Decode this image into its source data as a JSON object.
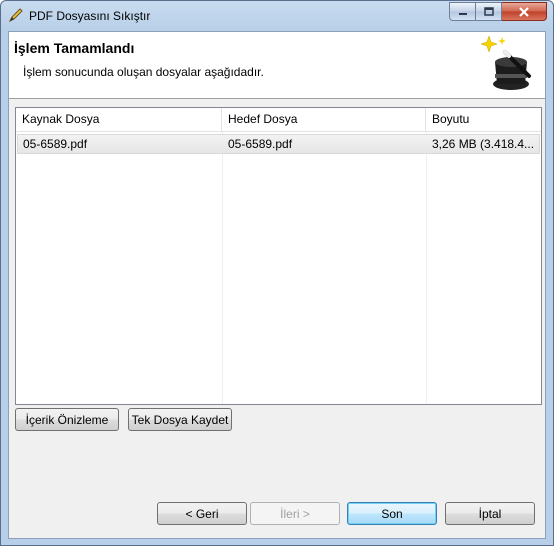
{
  "window": {
    "title": "PDF Dosyasını Sıkıştır",
    "controls": {
      "minimize": "minimize-icon",
      "maximize": "maximize-icon",
      "close": "close-icon"
    }
  },
  "header": {
    "title": "İşlem Tamamlandı",
    "description": "İşlem sonucunda oluşan dosyalar aşağıdadır.",
    "icon": "magic-hat-wand-icon"
  },
  "table": {
    "columns": [
      "Kaynak Dosya",
      "Hedef Dosya",
      "Boyutu"
    ],
    "rows": [
      {
        "source": "05-6589.pdf",
        "target": "05-6589.pdf",
        "size": "3,26 MB (3.418.4..."
      }
    ]
  },
  "actions": {
    "preview": "İçerik Önizleme",
    "save_single": "Tek Dosya Kaydet"
  },
  "nav": {
    "back": "< Geri",
    "next": "İleri >",
    "finish": "Son",
    "cancel": "İptal"
  }
}
